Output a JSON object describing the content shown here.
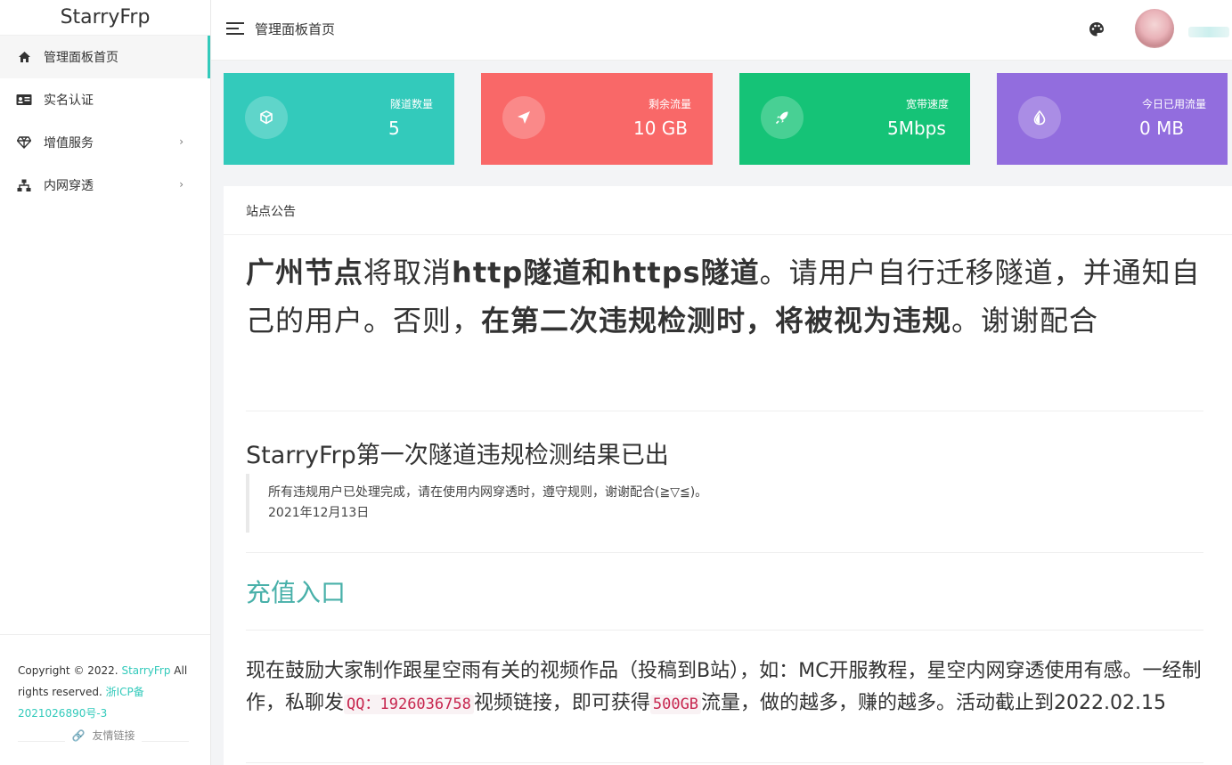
{
  "app": {
    "brand": "StarryFrp"
  },
  "colors": {
    "accent": "#33cabb",
    "card_tunnels": "#33cabb",
    "card_traffic": "#f96868",
    "card_bandwidth": "#15c377",
    "card_used": "#926dde"
  },
  "sidebar": {
    "items": [
      {
        "label": "管理面板首页",
        "icon": "home-icon"
      },
      {
        "label": "实名认证",
        "icon": "id-card-icon"
      },
      {
        "label": "增值服务",
        "icon": "diamond-icon"
      },
      {
        "label": "内网穿透",
        "icon": "sitemap-icon"
      }
    ],
    "footer": {
      "copyright_prefix": "Copyright © 2022.",
      "brand_link": "StarryFrp",
      "suffix": "All rights reserved.",
      "icp": "浙ICP备2021026890号-3"
    },
    "friend_links": "友情链接"
  },
  "header": {
    "title": "管理面板首页",
    "palette_icon": "palette-icon"
  },
  "stats": [
    {
      "label": "隧道数量",
      "value": "5",
      "icon": "cube-icon"
    },
    {
      "label": "剩余流量",
      "value": "10 GB",
      "icon": "send-icon"
    },
    {
      "label": "宽带速度",
      "value": "5Mbps",
      "icon": "rocket-icon"
    },
    {
      "label": "今日已用流量",
      "value": "0 MB",
      "icon": "drop-icon"
    }
  ],
  "announcement": {
    "panel_title": "站点公告",
    "h1_bold1": "广州节点",
    "h1_normal1": "将取消",
    "h1_bold2": "http隧道和https隧道",
    "h1_normal2": "。请用户自行迁移隧道，并通知自己的用户。否则，",
    "h1_bold3": "在第二次违规检测时，将被视为违规",
    "h1_normal3": "。谢谢配合",
    "h2": "StarryFrp第一次隧道违规检测结果已出",
    "quote_text": "所有违规用户已处理完成，请在使用内网穿透时，遵守规则，谢谢配合(≧▽≦)。",
    "quote_date": "2021年12月13日",
    "h3": "充值入口",
    "para_1": "现在鼓励大家制作跟星空雨有关的视频作品（投稿到B站），如：MC开服教程，星空内网穿透使用有感。一经制作，私聊发",
    "code_qq": "QQ：1926036758",
    "para_2": "视频链接，即可获得",
    "code_gb": "500GB",
    "para_3": "流量，做的越多，赚的越多。活动截止到2022.02.15"
  }
}
